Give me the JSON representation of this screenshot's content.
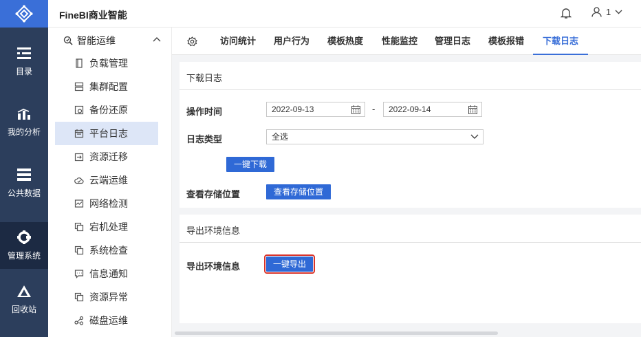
{
  "header": {
    "app_title": "FineBI商业智能",
    "user_name": "1"
  },
  "rail": {
    "items": [
      {
        "label": "目录",
        "icon": "directory-icon"
      },
      {
        "label": "我的分析",
        "icon": "analysis-icon"
      },
      {
        "label": "公共数据",
        "icon": "database-icon"
      },
      {
        "label": "管理系统",
        "icon": "system-gear-icon"
      },
      {
        "label": "回收站",
        "icon": "recycle-icon"
      }
    ],
    "active": "管理系统"
  },
  "subnav": {
    "group_label": "智能运维",
    "items": [
      {
        "label": "负载管理"
      },
      {
        "label": "集群配置"
      },
      {
        "label": "备份还原"
      },
      {
        "label": "平台日志"
      },
      {
        "label": "资源迁移"
      },
      {
        "label": "云端运维"
      },
      {
        "label": "网络检测"
      },
      {
        "label": "宕机处理"
      },
      {
        "label": "系统检查"
      },
      {
        "label": "信息通知"
      },
      {
        "label": "资源异常"
      },
      {
        "label": "磁盘运维"
      }
    ],
    "active": "平台日志"
  },
  "tabs": {
    "items": [
      "访问统计",
      "用户行为",
      "模板热度",
      "性能监控",
      "管理日志",
      "模板报错",
      "下载日志"
    ],
    "active": "下载日志"
  },
  "download_log": {
    "title": "下载日志",
    "op_time_label": "操作时间",
    "start_date": "2022-09-13",
    "end_date": "2022-09-14",
    "date_separator": "-",
    "log_type_label": "日志类型",
    "log_type_value": "全选",
    "download_button": "一键下载",
    "storage_label": "查看存储位置",
    "storage_button": "查看存储位置"
  },
  "export_env": {
    "title": "导出环境信息",
    "label": "导出环境信息",
    "export_button": "一键导出"
  },
  "colors": {
    "rail_bg": "#2c3e5c",
    "rail_active": "#1c2a43",
    "accent": "#3a6fd8",
    "button": "#2f69d6",
    "highlight_border": "#d9342b"
  }
}
